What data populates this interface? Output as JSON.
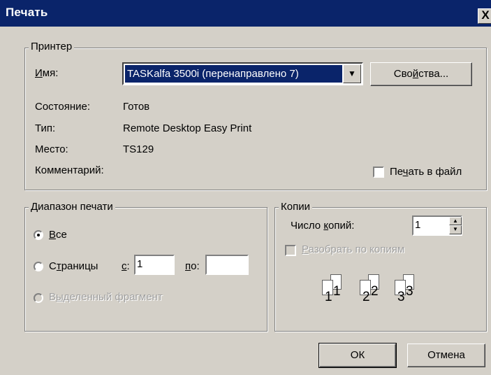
{
  "window": {
    "title": "Печать",
    "close_label": "X"
  },
  "printer": {
    "legend": "Принтер",
    "name_label": "Имя:",
    "name_value": "TASKalfa 3500i (перенаправлено 7)",
    "properties_button": "Свойства...",
    "status_label": "Состояние:",
    "status_value": "Готов",
    "type_label": "Тип:",
    "type_value": "Remote Desktop Easy Print",
    "location_label": "Место:",
    "location_value": "TS129",
    "comment_label": "Комментарий:",
    "print_to_file_label": "Печать в файл"
  },
  "range": {
    "legend": "Диапазон печати",
    "all_label": "Все",
    "pages_label": "Страницы",
    "from_label": "с:",
    "from_value": "1",
    "to_label": "по:",
    "to_value": "",
    "selection_label": "Выделенный фрагмент"
  },
  "copies": {
    "legend": "Копии",
    "count_label": "Число копий:",
    "count_value": "1",
    "collate_label": "Разобрать по копиям",
    "collate_icons": [
      "1",
      "1",
      "2",
      "2",
      "3",
      "3"
    ]
  },
  "buttons": {
    "ok": "ОК",
    "cancel": "Отмена"
  }
}
